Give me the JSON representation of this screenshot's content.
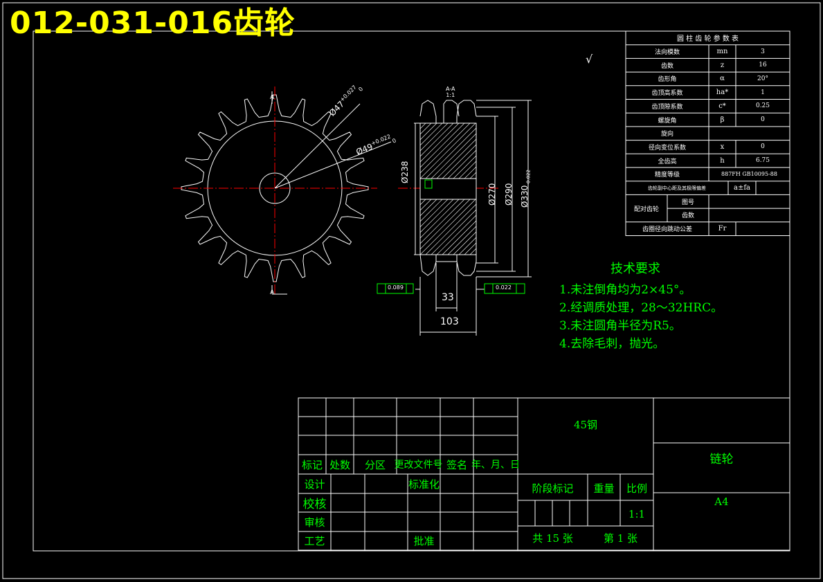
{
  "drawing_title": "012-031-016齿轮",
  "param_table": {
    "title": "圆 柱 齿 轮 参 数 表",
    "rows": [
      {
        "name": "法向模数",
        "symbol": "mn",
        "value": "3"
      },
      {
        "name": "齿数",
        "symbol": "z",
        "value": "16"
      },
      {
        "name": "齿形角",
        "symbol": "α",
        "value": "20°"
      },
      {
        "name": "齿顶高系数",
        "symbol": "ha*",
        "value": "1"
      },
      {
        "name": "齿顶隙系数",
        "symbol": "c*",
        "value": "0.25"
      },
      {
        "name": "螺旋角",
        "symbol": "β",
        "value": "0"
      },
      {
        "name": "旋向",
        "symbol": "",
        "value": ""
      },
      {
        "name": "径向变位系数",
        "symbol": "x",
        "value": "0"
      },
      {
        "name": "全齿高",
        "symbol": "h",
        "value": "6.75"
      },
      {
        "name": "精度等级",
        "symbol": "",
        "value": "887FH GB10095-88"
      },
      {
        "name": "齿轮副中心距及其极限偏差",
        "symbol": "a±fa",
        "value": ""
      },
      {
        "name": "配对齿轮",
        "symbol": "",
        "value": ""
      },
      {
        "name": "齿圈径向跳动公差",
        "symbol": "Fr",
        "value": ""
      }
    ],
    "pair_sub": [
      "图号",
      "齿数"
    ]
  },
  "tech_req": {
    "title": "技术要求",
    "items": [
      "1.未注倒角均为2×45°。",
      "2.经调质处理，28～32HRC。",
      "3.未注圆角半径为R5。",
      "4.去除毛刺，抛光。"
    ]
  },
  "front_view": {
    "dim_top": "Ø47",
    "dim_top_tol": "+0.027",
    "dim_top_sub": "0",
    "dim_inner": "Ø49",
    "dim_inner_tol": "+0.022",
    "dim_inner_sub": "0",
    "section_mark": "A"
  },
  "section_view": {
    "label": "A-A",
    "scale": "1:1",
    "dia_left": "Ø238",
    "dia_270": "Ø270",
    "dia_290": "Ø290",
    "dia_330": "Ø330",
    "dia_330_tol": "-0.022",
    "width_hub": "33",
    "width_total": "103",
    "tol_left": "0.089",
    "tol_right": "0.022",
    "roughness": "√"
  },
  "title_block": {
    "material": "45钢",
    "part_name": "链轮",
    "paper": "A4",
    "labels": {
      "mark": "标记",
      "qty": "处数",
      "zone": "分区",
      "doc": "更改文件号",
      "sign": "签名",
      "date": "年、月、日",
      "design": "设计",
      "check": "校核",
      "review": "审核",
      "process": "工艺",
      "standard": "标准化",
      "approve": "批准",
      "stage": "阶段标记",
      "weight": "重量",
      "ratio": "比例",
      "scale_val": "1:1",
      "sheets": "共  15  张",
      "sheet_no": "第  1  张"
    }
  }
}
